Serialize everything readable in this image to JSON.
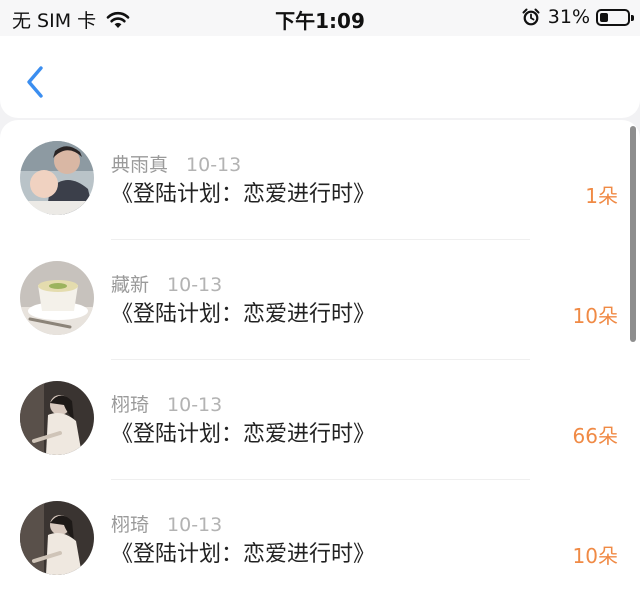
{
  "status_bar": {
    "carrier": "无 SIM 卡",
    "time": "下午1:09",
    "battery_percent": "31%",
    "battery_level": 0.31,
    "icons": [
      "wifi-icon",
      "alarm-icon",
      "battery-icon"
    ]
  },
  "nav": {
    "back_icon": "chevron-left-icon",
    "accent_color": "#3b8ef0"
  },
  "list": [
    {
      "name": "典雨真",
      "date": "10-13",
      "title": "《登陆计划：恋爱进行时》",
      "amount": "1朵"
    },
    {
      "name": "藏新",
      "date": "10-13",
      "title": "《登陆计划：恋爱进行时》",
      "amount": "10朵"
    },
    {
      "name": "栩琦",
      "date": "10-13",
      "title": "《登陆计划：恋爱进行时》",
      "amount": "66朵"
    },
    {
      "name": "栩琦",
      "date": "10-13",
      "title": "《登陆计划：恋爱进行时》",
      "amount": "10朵"
    }
  ],
  "colors": {
    "amount": "#f08a45",
    "name": "#9a9a9a",
    "title": "#222222"
  }
}
